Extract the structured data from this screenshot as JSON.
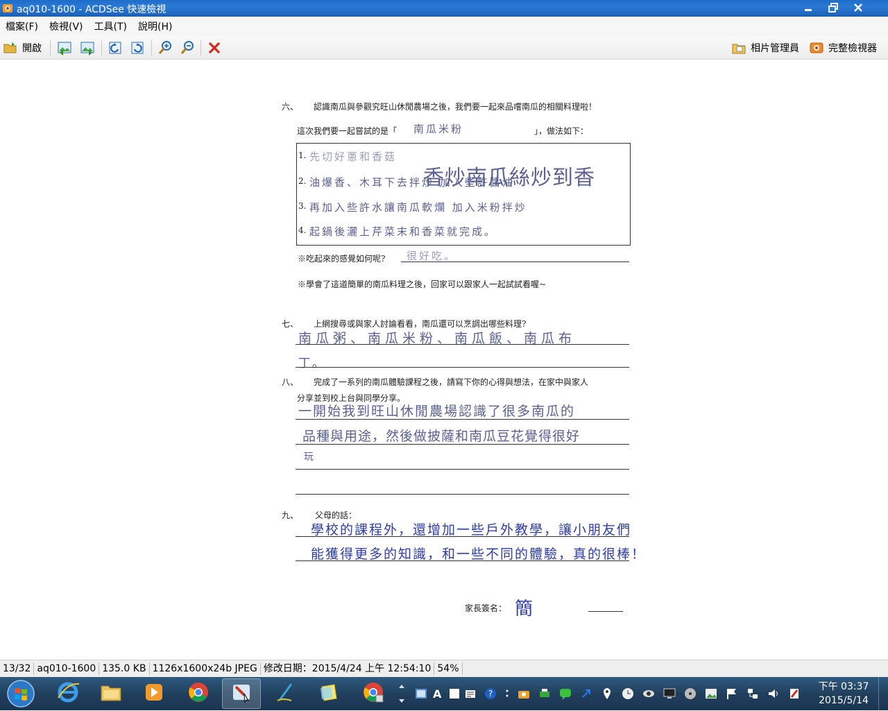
{
  "window": {
    "title": "aq010-1600 - ACDSee 快速檢視"
  },
  "menu": [
    "檔案(F)",
    "檢視(V)",
    "工具(T)",
    "說明(H)"
  ],
  "toolbar": {
    "open_label": "開啟",
    "photo_manager_label": "相片管理員",
    "full_viewer_label": "完整檢視器"
  },
  "document": {
    "q6_num": "六、",
    "q6_text": "認識南瓜與參觀究旺山休閒農場之後，我們要一起來品嚐南瓜的相關料理啦！",
    "q6_try_prefix": "這次我們要一起嘗試的是「",
    "q6_try_answer": "南瓜米粉",
    "q6_try_suffix": "」，做法如下：",
    "step1_num": "1.",
    "step1_text": "先切好蔥和香菇",
    "step1_overlay": "香炒南瓜絲炒到香",
    "step2_num": "2.",
    "step2_text": "油爆香、木耳下去拌炒 加入些許醬油",
    "step3_num": "3.",
    "step3_text": "再加入些許水讓南瓜軟爛 加入米粉拌炒",
    "step4_num": "4.",
    "step4_text": "起鍋後灑上芹菜末和香菜就完成。",
    "q6_feeling_label": "※吃起來的感覺如何呢?",
    "q6_feeling_answer": "很好吃。",
    "q6_note": "※學會了這道簡單的南瓜料理之後，回家可以跟家人一起試試看喔~",
    "q7_num": "七、",
    "q7_text": "上網搜尋或與家人討論看看，南瓜還可以烹調出哪些料理?",
    "q7_answer_line1": "南瓜粥、南瓜米粉、南瓜飯、南瓜布",
    "q7_answer_line2": "丁。",
    "q8_num": "八、",
    "q8_text": "完成了一系列的南瓜體驗課程之後，請寫下你的心得與想法，在家中與家人",
    "q8_text2": "分享並到校上台與同學分享。",
    "q8_answer_line1": "一開始我到旺山休閒農場認識了很多南瓜的",
    "q8_answer_line2": "品種與用途，然後做披薩和南瓜豆花覺得很好",
    "q8_answer_line3": "玩",
    "q9_num": "九、",
    "q9_text": "父母的話：",
    "q9_answer_line1": "學校的課程外，還增加一些戶外教學，讓小朋友們",
    "q9_answer_line2": "能獲得更多的知識，和一些不同的體驗，真的很棒！",
    "signature_label": "家長簽名：",
    "signature": "簡"
  },
  "status": {
    "position": "13/32",
    "filename": "aq010-1600",
    "filesize": "135.0 KB",
    "dimensions": "1126x1600x24b JPEG",
    "modified": "修改日期：2015/4/24 上午 12:54:10",
    "zoom": "54%"
  },
  "taskbar": {
    "time": "下午 03:37",
    "date": "2015/5/14"
  },
  "colors": {
    "titlebar": "#1f6cc9",
    "taskbar": "#21405e",
    "handwriting_pencil": "#5b6190",
    "handwriting_pen": "#2e3ea6"
  }
}
